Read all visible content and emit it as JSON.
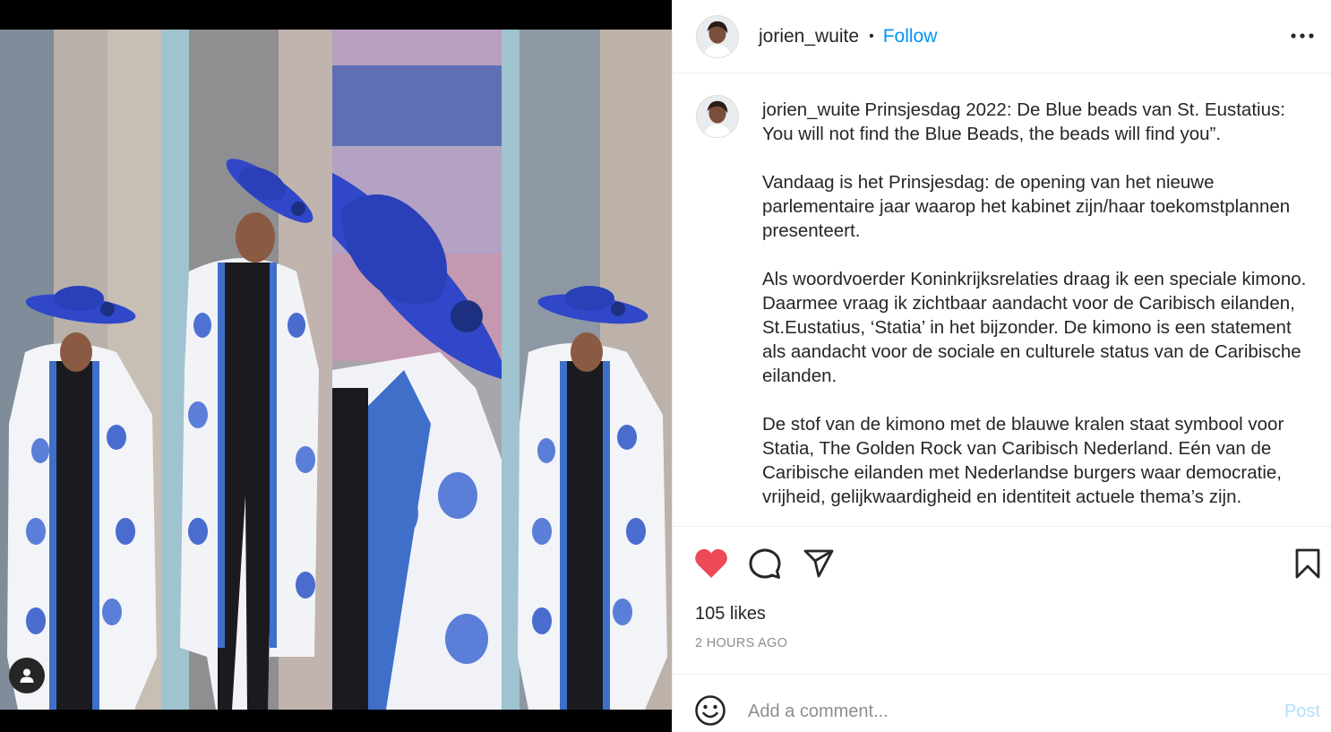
{
  "post": {
    "username": "jorien_wuite",
    "follow_label": "Follow",
    "separator": "•",
    "more_icon": "more-options-icon"
  },
  "caption": {
    "username": "jorien_wuite",
    "paragraphs": [
      "Prinsjesdag 2022: De Blue beads van St. Eustatius: You will not find the Blue Beads, the beads will find you”.",
      "Vandaag is het Prinsjesdag: de opening van het nieuwe parlementaire jaar waarop het kabinet zijn/haar toekomstplannen presenteert.",
      "Als woordvoerder Koninkrijksrelaties draag ik een speciale kimono. Daarmee vraag ik zichtbaar aandacht voor de Caribisch eilanden, St.Eustatius, ‘Statia’ in het bijzonder. De kimono is een statement als aandacht voor de sociale en culturele status van de Caribische eilanden.",
      "De stof van de kimono met de blauwe kralen staat symbool voor Statia, The Golden Rock van Caribisch Nederland. Eén van de Caribische eilanden met Nederlandse burgers waar democratie, vrijheid, gelijkwaardigheid en identiteit actuele thema’s zijn."
    ]
  },
  "actions": {
    "like_icon": "heart-filled-icon",
    "comment_icon": "comment-icon",
    "share_icon": "share-icon",
    "save_icon": "bookmark-icon",
    "liked": true
  },
  "stats": {
    "likes": "105 likes",
    "posted": "2 HOURS AGO"
  },
  "comment": {
    "placeholder": "Add a comment...",
    "post_label": "Post"
  },
  "colors": {
    "accent": "#0095f6",
    "like_red": "#ed4956",
    "post_disabled": "#b2dffc",
    "hat_blue": "#2f47c8"
  }
}
